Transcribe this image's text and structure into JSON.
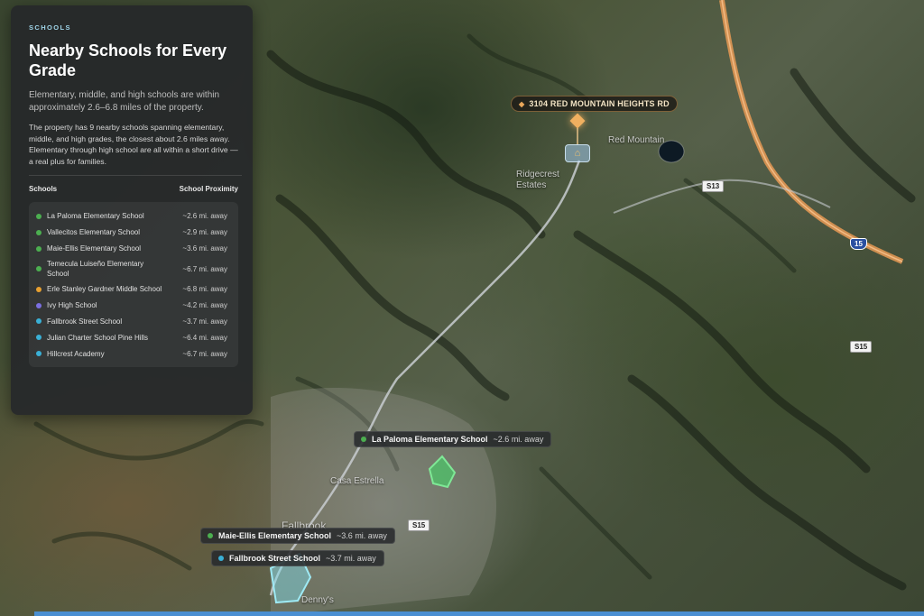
{
  "panel": {
    "eyebrow": "SCHOOLS",
    "title": "Nearby Schools for Every Grade",
    "subtitle": "Elementary, middle, and high schools are within approximately 2.6–6.8 miles of the property.",
    "body": "The property has 9 nearby schools spanning elementary, middle, and high grades, the closest about 2.6 miles away. Elementary through high school are all within a short drive — a real plus for families.",
    "col_schools": "Schools",
    "col_proximity": "School Proximity",
    "schools": [
      {
        "name": "La Paloma Elementary School",
        "distance": "~2.6 mi. away",
        "color": "#4caf50"
      },
      {
        "name": "Vallecitos Elementary School",
        "distance": "~2.9 mi. away",
        "color": "#4caf50"
      },
      {
        "name": "Maie-Ellis Elementary School",
        "distance": "~3.6 mi. away",
        "color": "#4caf50"
      },
      {
        "name": "Temecula Luiseño Elementary School",
        "distance": "~6.7 mi. away",
        "color": "#4caf50"
      },
      {
        "name": "Erle Stanley Gardner Middle School",
        "distance": "~6.8 mi. away",
        "color": "#e8a030"
      },
      {
        "name": "Ivy High School",
        "distance": "~4.2 mi. away",
        "color": "#7b6fe0"
      },
      {
        "name": "Fallbrook Street School",
        "distance": "~3.7 mi. away",
        "color": "#3ab0d6"
      },
      {
        "name": "Julian Charter School Pine Hills",
        "distance": "~6.4 mi. away",
        "color": "#3ab0d6"
      },
      {
        "name": "Hillcrest Academy",
        "distance": "~6.7 mi. away",
        "color": "#3ab0d6"
      }
    ]
  },
  "map": {
    "property_label": "3104 RED MOUNTAIN HEIGHTS RD",
    "place_red_mountain": "Red Mountain",
    "place_ridgecrest": "Ridgecrest Estates",
    "place_casa_estrella": "Casa Estrella",
    "place_fallbrook": "Fallbrook",
    "place_dennys": "Denny's",
    "road_i15": "15",
    "road_s13": "S13",
    "road_s15_a": "S15",
    "road_s15_b": "S15",
    "callouts": [
      {
        "name": "La Paloma Elementary School",
        "distance": "~2.6 mi. away",
        "color": "#4caf50"
      },
      {
        "name": "Maie-Ellis Elementary School",
        "distance": "~3.6 mi. away",
        "color": "#4caf50"
      },
      {
        "name": "Fallbrook Street School",
        "distance": "~3.7 mi. away",
        "color": "#3ab0d6"
      }
    ],
    "colors": {
      "highway": "#e89a55",
      "route": "#c8ccd0",
      "school_area": "#4ec46a",
      "school_area_2": "#7ee0f0"
    }
  }
}
